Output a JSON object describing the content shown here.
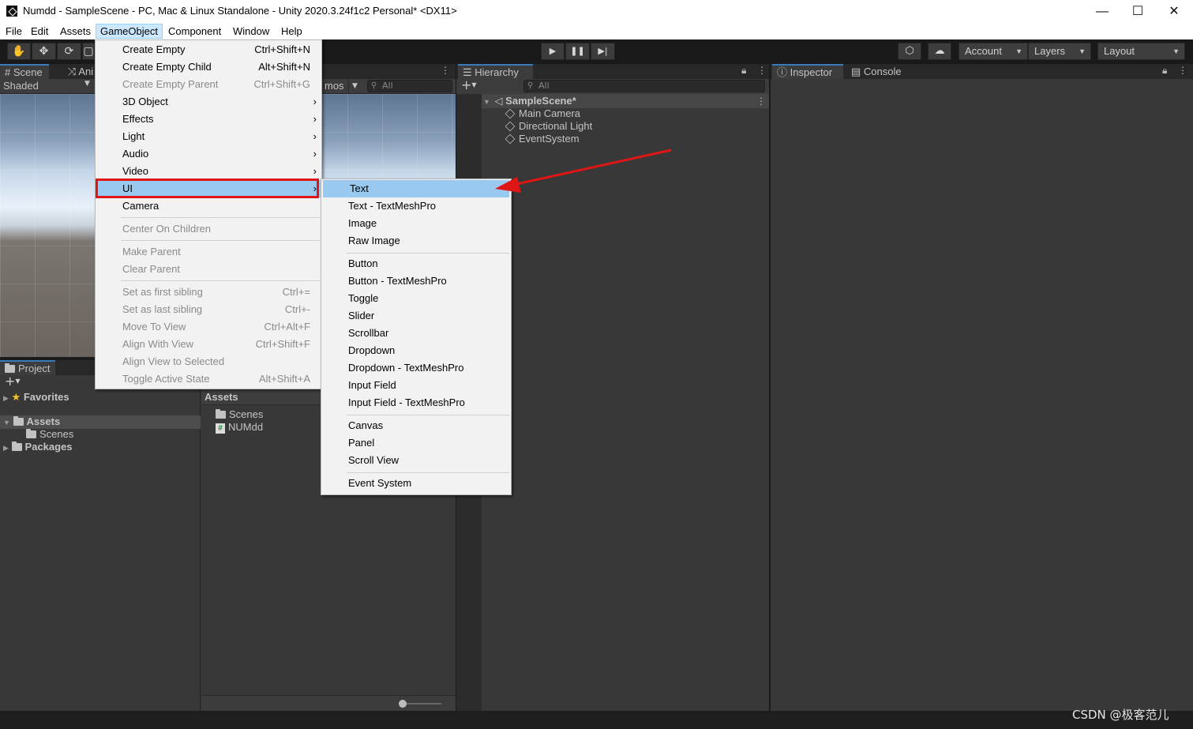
{
  "window": {
    "title": "Numdd - SampleScene - PC, Mac & Linux Standalone - Unity 2020.3.24f1c2 Personal* <DX11>",
    "minimize": "—",
    "maximize": "☐",
    "close": "✕"
  },
  "menubar": [
    "File",
    "Edit",
    "Assets",
    "GameObject",
    "Component",
    "Window",
    "Help"
  ],
  "toolbar": {
    "account": "Account",
    "layers": "Layers",
    "layout": "Layout"
  },
  "scene": {
    "tabs": [
      "Scene",
      "Ani"
    ],
    "shading": "Shaded",
    "gizmos": "mos",
    "search_placeholder": "All"
  },
  "hierarchy": {
    "tab": "Hierarchy",
    "search_placeholder": "All",
    "scene_name": "SampleScene*",
    "objects": [
      "Main Camera",
      "Directional Light",
      "EventSystem"
    ]
  },
  "inspector": {
    "tabs": [
      "Inspector",
      "Console"
    ]
  },
  "project": {
    "tab": "Project",
    "favorites": "Favorites",
    "tree": [
      "Assets",
      "Scenes",
      "Packages"
    ],
    "breadcrumb": "Assets",
    "files": [
      "Scenes",
      "NUMdd"
    ]
  },
  "gameobject_menu": {
    "items": [
      {
        "label": "Create Empty",
        "shortcut": "Ctrl+Shift+N",
        "disabled": false
      },
      {
        "label": "Create Empty Child",
        "shortcut": "Alt+Shift+N",
        "disabled": false
      },
      {
        "label": "Create Empty Parent",
        "shortcut": "Ctrl+Shift+G",
        "disabled": true
      },
      {
        "label": "3D Object",
        "submenu": true
      },
      {
        "label": "Effects",
        "submenu": true
      },
      {
        "label": "Light",
        "submenu": true
      },
      {
        "label": "Audio",
        "submenu": true
      },
      {
        "label": "Video",
        "submenu": true
      },
      {
        "label": "UI",
        "submenu": true,
        "highlighted": true
      },
      {
        "label": "Camera"
      },
      {
        "label": "Center On Children",
        "disabled": true
      },
      {
        "label": "Make Parent",
        "disabled": true
      },
      {
        "label": "Clear Parent",
        "disabled": true
      },
      {
        "label": "Set as first sibling",
        "shortcut": "Ctrl+=",
        "disabled": true
      },
      {
        "label": "Set as last sibling",
        "shortcut": "Ctrl+-",
        "disabled": true
      },
      {
        "label": "Move To View",
        "shortcut": "Ctrl+Alt+F",
        "disabled": true
      },
      {
        "label": "Align With View",
        "shortcut": "Ctrl+Shift+F",
        "disabled": true
      },
      {
        "label": "Align View to Selected",
        "disabled": true
      },
      {
        "label": "Toggle Active State",
        "shortcut": "Alt+Shift+A",
        "disabled": true
      }
    ]
  },
  "ui_submenu": {
    "items": [
      "Text",
      "Text - TextMeshPro",
      "Image",
      "Raw Image",
      "Button",
      "Button - TextMeshPro",
      "Toggle",
      "Slider",
      "Scrollbar",
      "Dropdown",
      "Dropdown - TextMeshPro",
      "Input Field",
      "Input Field - TextMeshPro",
      "Canvas",
      "Panel",
      "Scroll View",
      "Event System"
    ]
  },
  "watermark": "CSDN @极客范儿",
  "colors": {
    "highlight_box": "#e01515",
    "arrow": "#e01515",
    "menu_hover": "#99c9ef",
    "menubar_active": "#cce8ff"
  }
}
